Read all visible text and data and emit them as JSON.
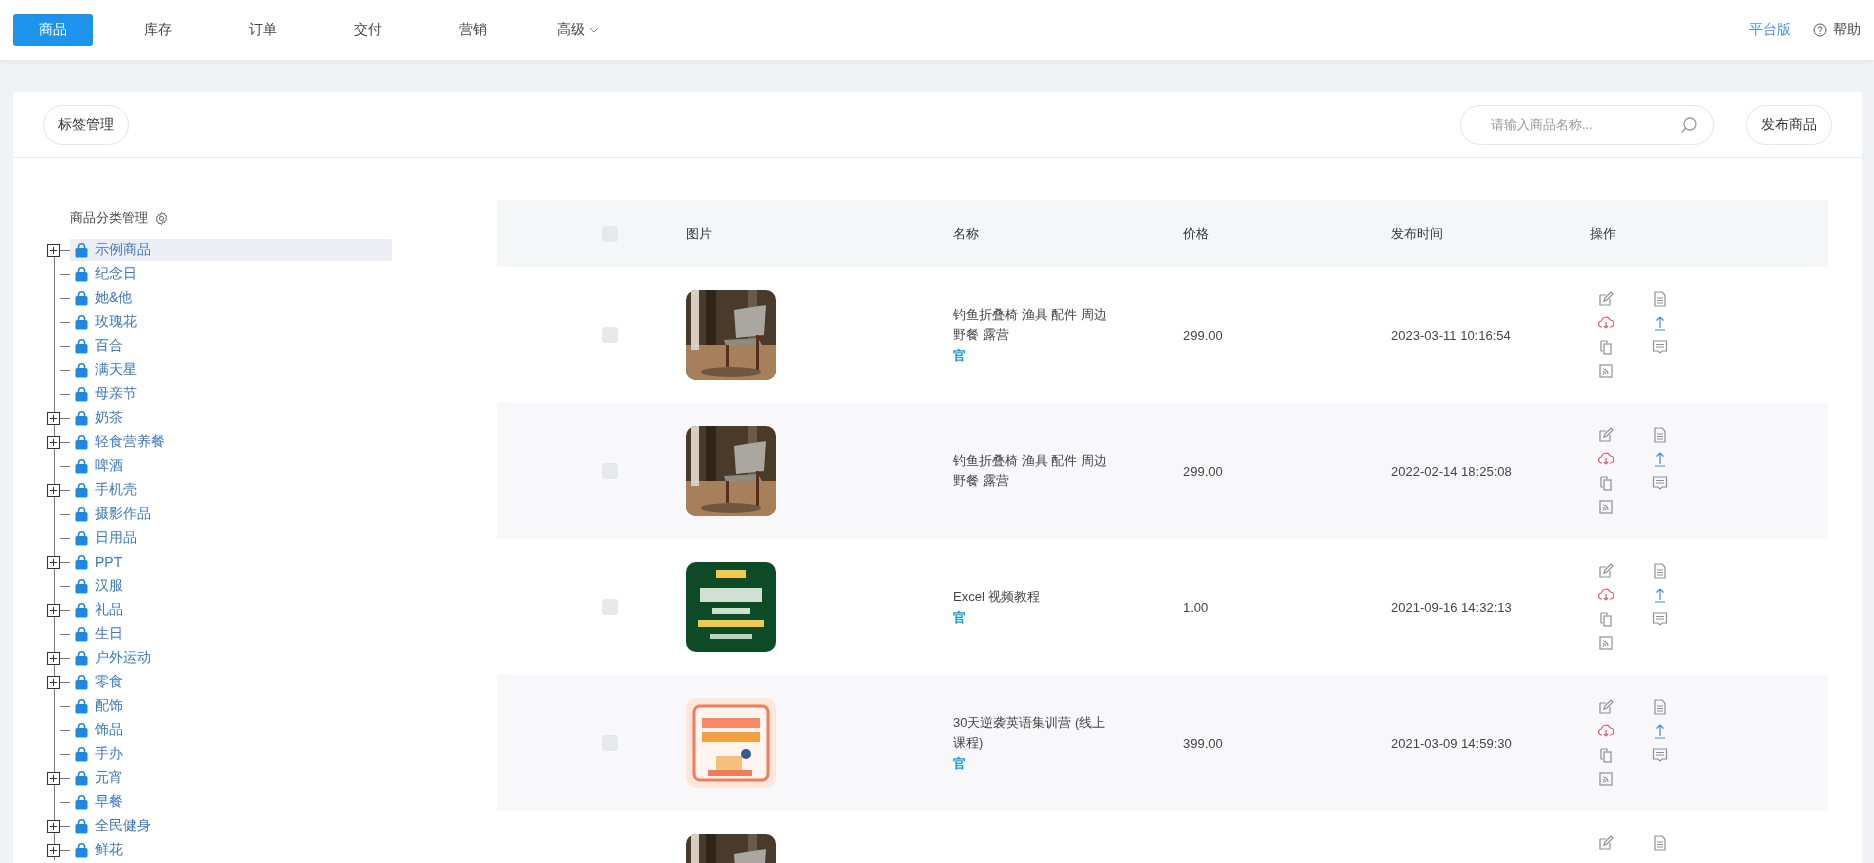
{
  "nav": {
    "tabs": [
      {
        "label": "商品",
        "selected": true
      },
      {
        "label": "库存",
        "selected": false
      },
      {
        "label": "订单",
        "selected": false
      },
      {
        "label": "交付",
        "selected": false
      },
      {
        "label": "营销",
        "selected": false
      },
      {
        "label": "高级",
        "selected": false,
        "dropdown": true
      }
    ],
    "platform_link": "平台版",
    "help": "帮助"
  },
  "toolbar": {
    "tag_button": "标签管理",
    "search": {
      "placeholder": "请输入商品名称..."
    },
    "publish_button": "发布商品"
  },
  "category_tree": {
    "title": "商品分类管理",
    "items": [
      {
        "label": "示例商品",
        "kind": "folder",
        "selected": true
      },
      {
        "label": "纪念日",
        "kind": "leaf",
        "selected": false
      },
      {
        "label": "她&他",
        "kind": "leaf",
        "selected": false
      },
      {
        "label": "玫瑰花",
        "kind": "leaf",
        "selected": false
      },
      {
        "label": "百合",
        "kind": "leaf",
        "selected": false
      },
      {
        "label": "满天星",
        "kind": "leaf",
        "selected": false
      },
      {
        "label": "母亲节",
        "kind": "leaf",
        "selected": false
      },
      {
        "label": "奶茶",
        "kind": "folder",
        "selected": false
      },
      {
        "label": "轻食营养餐",
        "kind": "folder",
        "selected": false
      },
      {
        "label": "啤酒",
        "kind": "leaf",
        "selected": false
      },
      {
        "label": "手机壳",
        "kind": "folder",
        "selected": false
      },
      {
        "label": "摄影作品",
        "kind": "leaf",
        "selected": false
      },
      {
        "label": "日用品",
        "kind": "leaf",
        "selected": false
      },
      {
        "label": "PPT",
        "kind": "folder",
        "selected": false
      },
      {
        "label": "汉服",
        "kind": "leaf",
        "selected": false
      },
      {
        "label": "礼品",
        "kind": "folder",
        "selected": false
      },
      {
        "label": "生日",
        "kind": "leaf",
        "selected": false
      },
      {
        "label": "户外运动",
        "kind": "folder",
        "selected": false
      },
      {
        "label": "零食",
        "kind": "folder",
        "selected": false
      },
      {
        "label": "配饰",
        "kind": "leaf",
        "selected": false
      },
      {
        "label": "饰品",
        "kind": "leaf",
        "selected": false
      },
      {
        "label": "手办",
        "kind": "leaf",
        "selected": false
      },
      {
        "label": "元宵",
        "kind": "folder",
        "selected": false
      },
      {
        "label": "早餐",
        "kind": "leaf",
        "selected": false
      },
      {
        "label": "全民健身",
        "kind": "folder",
        "selected": false
      },
      {
        "label": "鲜花",
        "kind": "folder",
        "selected": false
      }
    ]
  },
  "table": {
    "header_checked": false,
    "columns": [
      "图片",
      "名称",
      "价格",
      "发布时间",
      "操作"
    ],
    "rows": [
      {
        "checked": false,
        "name": "钓鱼折叠椅 渔具 配件 周边野餐 露营",
        "badge": "官",
        "price": "299.00",
        "published": "2023-03-11 10:16:54"
      },
      {
        "checked": false,
        "name": "钓鱼折叠椅 渔具 配件 周边野餐 露营",
        "price": "299.00",
        "published": "2022-02-14 18:25:08"
      },
      {
        "checked": false,
        "name": "Excel 视频教程",
        "badge": "官",
        "price": "1.00",
        "published": "2021-09-16 14:32:13"
      },
      {
        "checked": false,
        "name": "30天逆袭英语集训营 (线上课程)",
        "badge": "官",
        "price": "399.00",
        "published": "2021-03-09 14:59:30"
      },
      {}
    ]
  }
}
